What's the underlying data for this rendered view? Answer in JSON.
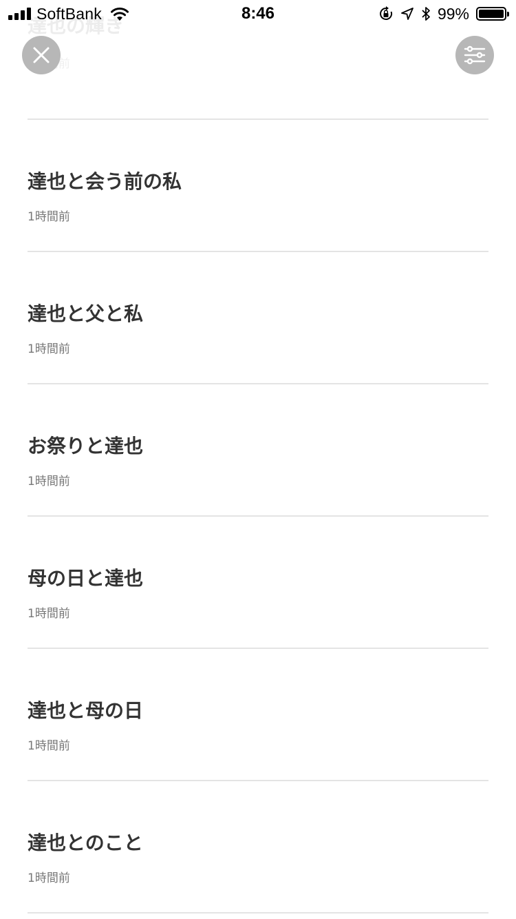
{
  "status_bar": {
    "carrier": "SoftBank",
    "time": "8:46",
    "battery_percent": "99%",
    "battery_level": 0.99,
    "icons": [
      "signal-icon",
      "wifi-icon",
      "orientation-lock-icon",
      "location-icon",
      "bluetooth-icon",
      "battery-icon"
    ]
  },
  "toolbar": {
    "close_icon": "close-icon",
    "filter_icon": "filter-sliders-icon"
  },
  "posts": [
    {
      "title": "達也の輝き",
      "time": "1時間前"
    },
    {
      "title": "達也と会う前の私",
      "time": "1時間前"
    },
    {
      "title": "達也と父と私",
      "time": "1時間前"
    },
    {
      "title": "お祭りと達也",
      "time": "1時間前"
    },
    {
      "title": "母の日と達也",
      "time": "1時間前"
    },
    {
      "title": "達也と母の日",
      "time": "1時間前"
    },
    {
      "title": "達也とのこと",
      "time": "1時間前"
    }
  ],
  "colors": {
    "button_bg": "#b7b7b7",
    "title_text": "#333333",
    "meta_text": "#777777",
    "divider": "#e4e4e4"
  }
}
